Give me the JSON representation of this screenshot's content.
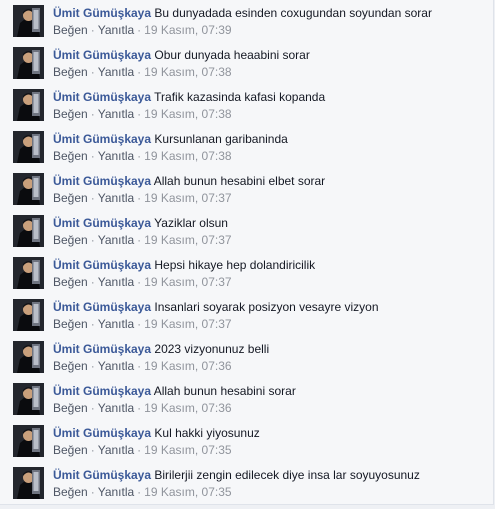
{
  "comments": [
    {
      "author": "Ümit Gümüşkaya",
      "text": "Bu dunyadada esinden coxugundan soyundan sorar",
      "like_label": "Beğen",
      "reply_label": "Yanıtla",
      "time": "19 Kasım, 07:39"
    },
    {
      "author": "Ümit Gümüşkaya",
      "text": "Obur dunyada heaabini sorar",
      "like_label": "Beğen",
      "reply_label": "Yanıtla",
      "time": "19 Kasım, 07:38"
    },
    {
      "author": "Ümit Gümüşkaya",
      "text": "Trafik kazasinda kafasi kopanda",
      "like_label": "Beğen",
      "reply_label": "Yanıtla",
      "time": "19 Kasım, 07:38"
    },
    {
      "author": "Ümit Gümüşkaya",
      "text": "Kursunlanan garibaninda",
      "like_label": "Beğen",
      "reply_label": "Yanıtla",
      "time": "19 Kasım, 07:38"
    },
    {
      "author": "Ümit Gümüşkaya",
      "text": "Allah bunun hesabini elbet sorar",
      "like_label": "Beğen",
      "reply_label": "Yanıtla",
      "time": "19 Kasım, 07:37"
    },
    {
      "author": "Ümit Gümüşkaya",
      "text": "Yaziklar olsun",
      "like_label": "Beğen",
      "reply_label": "Yanıtla",
      "time": "19 Kasım, 07:37"
    },
    {
      "author": "Ümit Gümüşkaya",
      "text": "Hepsi hikaye hep dolandiricilik",
      "like_label": "Beğen",
      "reply_label": "Yanıtla",
      "time": "19 Kasım, 07:37"
    },
    {
      "author": "Ümit Gümüşkaya",
      "text": "Insanlari soyarak posizyon vesayre vizyon",
      "like_label": "Beğen",
      "reply_label": "Yanıtla",
      "time": "19 Kasım, 07:37"
    },
    {
      "author": "Ümit Gümüşkaya",
      "text": "2023 vizyonunuz belli",
      "like_label": "Beğen",
      "reply_label": "Yanıtla",
      "time": "19 Kasım, 07:36"
    },
    {
      "author": "Ümit Gümüşkaya",
      "text": "Allah bunun hesabini sorar",
      "like_label": "Beğen",
      "reply_label": "Yanıtla",
      "time": "19 Kasım, 07:36"
    },
    {
      "author": "Ümit Gümüşkaya",
      "text": "Kul hakki yiyosunuz",
      "like_label": "Beğen",
      "reply_label": "Yanıtla",
      "time": "19 Kasım, 07:35"
    },
    {
      "author": "Ümit Gümüşkaya",
      "text": "Birilerjii zengin edilecek diye insa lar soyuyosunuz",
      "like_label": "Beğen",
      "reply_label": "Yanıtla",
      "time": "19 Kasım, 07:35"
    }
  ],
  "colors": {
    "author_link": "#3b5998",
    "comment_text": "#141823",
    "action_text": "#4e5665",
    "meta_text": "#90949c",
    "panel_background": "#f6f7f9"
  },
  "icons": {
    "avatar": "user-avatar-photo"
  }
}
